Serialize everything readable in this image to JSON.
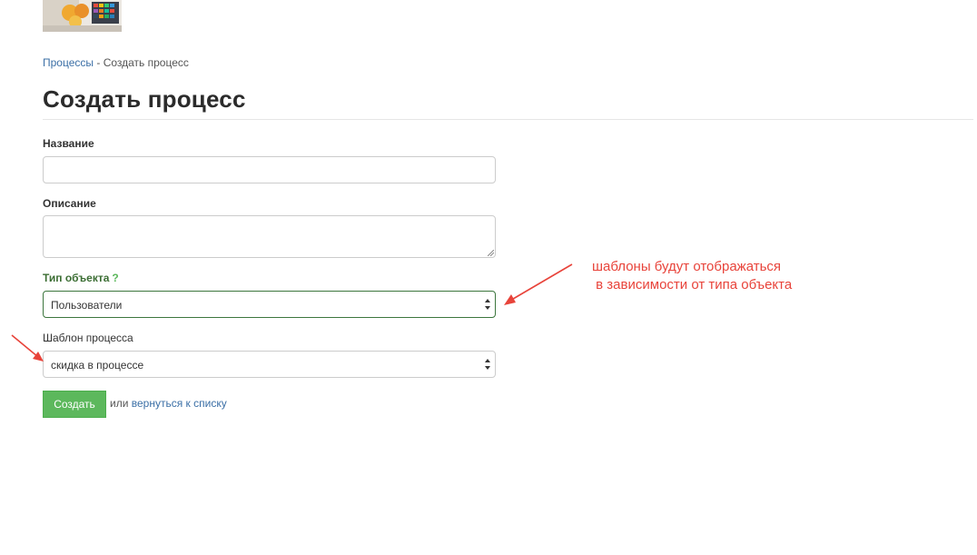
{
  "breadcrumb": {
    "parent_label": "Процессы",
    "separator": " - ",
    "current_label": "Создать процесс"
  },
  "page": {
    "title": "Создать процесс"
  },
  "form": {
    "name": {
      "label": "Название",
      "value": ""
    },
    "description": {
      "label": "Описание",
      "value": ""
    },
    "object_type": {
      "label": "Тип объекта",
      "help": "?",
      "selected": "Пользователи"
    },
    "template": {
      "label": "Шаблон процесса",
      "selected": "скидка в процессе"
    },
    "submit_label": "Создать",
    "or_text": "или",
    "back_link_label": "вернуться к списку"
  },
  "annotation": {
    "text": "шаблоны будут отображаться\n в зависимости от типа объекта"
  },
  "colors": {
    "link": "#3b6fa6",
    "success_label": "#3c6e34",
    "success_border": "#3c763d",
    "button_green": "#5cb85c",
    "annotation_red": "#e8433a"
  },
  "icons": {
    "select_arrows": "updown-arrows-icon",
    "help": "question-mark-icon"
  }
}
